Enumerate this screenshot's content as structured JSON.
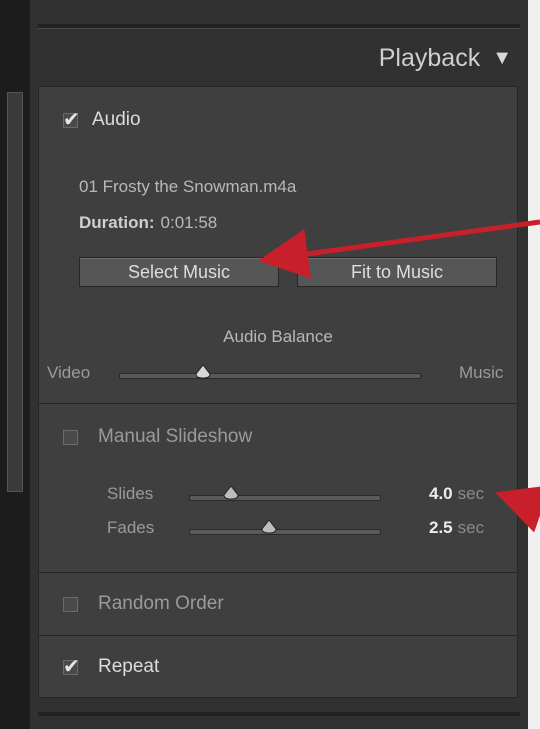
{
  "panel": {
    "title": "Playback",
    "collapse_icon": "triangle-down-icon"
  },
  "audio": {
    "label": "Audio",
    "checked": true,
    "track_name": "01 Frosty the Snowman.m4a",
    "duration_label": "Duration:",
    "duration_value": "0:01:58",
    "select_music_label": "Select Music",
    "fit_to_music_label": "Fit to Music",
    "balance_title": "Audio Balance",
    "balance_left_label": "Video",
    "balance_right_label": "Music",
    "balance_value": 0.28
  },
  "manual_slideshow": {
    "label": "Manual Slideshow",
    "checked": false,
    "slides_label": "Slides",
    "slides_value": "4.0",
    "slides_unit": "sec",
    "slides_level": 0.22,
    "fades_label": "Fades",
    "fades_value": "2.5",
    "fades_unit": "sec",
    "fades_level": 0.42
  },
  "random_order": {
    "label": "Random Order",
    "checked": false
  },
  "repeat": {
    "label": "Repeat",
    "checked": true
  },
  "colors": {
    "panel_bg": "#313131",
    "section_bg": "#3f3f3f",
    "annotation_arrow": "#c8202a"
  }
}
